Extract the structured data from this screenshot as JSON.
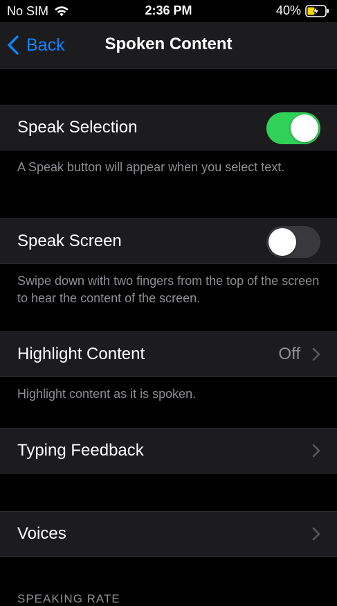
{
  "status": {
    "carrier": "No SIM",
    "time": "2:36 PM",
    "battery": "40%"
  },
  "nav": {
    "back_label": "Back",
    "title": "Spoken Content"
  },
  "rows": {
    "speak_selection": {
      "label": "Speak Selection",
      "on": true
    },
    "speak_selection_footer": "A Speak button will appear when you select text.",
    "speak_screen": {
      "label": "Speak Screen",
      "on": false
    },
    "speak_screen_footer": "Swipe down with two fingers from the top of the screen to hear the content of the screen.",
    "highlight_content": {
      "label": "Highlight Content",
      "value": "Off"
    },
    "highlight_footer": "Highlight content as it is spoken.",
    "typing_feedback": {
      "label": "Typing Feedback"
    },
    "voices": {
      "label": "Voices"
    }
  },
  "section_header": "SPEAKING RATE",
  "colors": {
    "accent": "#0a84ff",
    "toggle_on": "#30d158",
    "toggle_off": "#39393d",
    "cell_bg": "#1c1c1e",
    "secondary_text": "#8e8e93"
  }
}
